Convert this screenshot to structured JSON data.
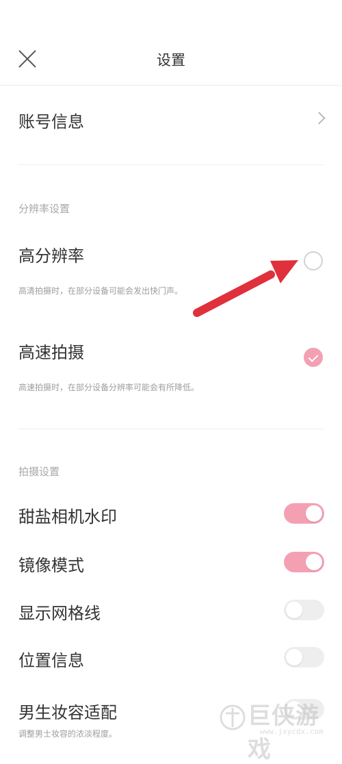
{
  "header": {
    "title": "设置"
  },
  "account": {
    "label": "账号信息"
  },
  "resolution_section": {
    "title": "分辨率设置",
    "options": [
      {
        "label": "高分辨率",
        "desc": "高清拍摄时，在部分设备可能会发出快门声。",
        "selected": false
      },
      {
        "label": "高速拍摄",
        "desc": "高速拍摄时，在部分设备分辨率可能会有所降低。",
        "selected": true
      }
    ]
  },
  "shooting_section": {
    "title": "拍摄设置",
    "toggles": [
      {
        "label": "甜盐相机水印",
        "on": true
      },
      {
        "label": "镜像模式",
        "on": true
      },
      {
        "label": "显示网格线",
        "on": false
      },
      {
        "label": "位置信息",
        "on": false
      },
      {
        "label": "男生妆容适配",
        "desc": "调整男士妆容的浓淡程度。",
        "on": false
      }
    ]
  },
  "watermark": {
    "text": "巨侠游戏",
    "url": "www.jxycdx.com"
  },
  "colors": {
    "accent": "#f4a0b3",
    "arrow": "#e0303c"
  }
}
